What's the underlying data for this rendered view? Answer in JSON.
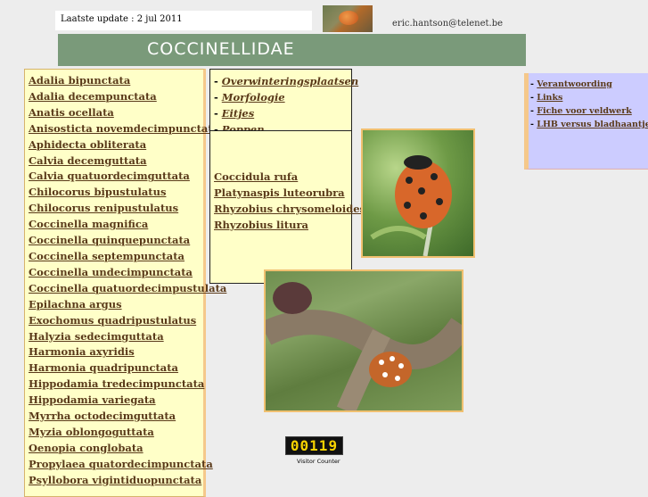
{
  "header": {
    "update_text": "Laatste update : 2 jul 2011",
    "email": "eric.hantson@telenet.be",
    "title": "COCCINELLIDAE"
  },
  "species": [
    "Adalia bipunctata",
    "Adalia decempunctata",
    "Anatis ocellata",
    "Anisosticta novemdecimpunctata",
    "Aphidecta obliterata",
    "Calvia decemguttata",
    "Calvia quatuordecimguttata",
    "Chilocorus bipustulatus",
    "Chilocorus renipustulatus",
    "Coccinella magnifica",
    "Coccinella quinquepunctata",
    "Coccinella septempunctata",
    "Coccinella undecimpunctata",
    "Coccinella quatuordecimpustulata",
    "Epilachna argus",
    "Exochomus quadripustulatus",
    "Halyzia sedecimguttata",
    "Harmonia axyridis",
    "Harmonia quadripunctata",
    "Hippodamia tredecimpunctata",
    "Hippodamia variegata",
    "Myrrha octodecimguttata",
    "Myzia oblongoguttata",
    "Oenopia conglobata",
    "Propylaea quatordecimpunctata",
    "Psyllobora vigintiduopunctata"
  ],
  "topics": [
    "Overwinteringsplaatsen",
    "Morfologie",
    "Eitjes",
    "Poppen"
  ],
  "species_mid": [
    "Coccidula rufa",
    "Platynaspis luteorubra",
    "Rhyzobius chrysomeloides",
    "Rhyzobius litura"
  ],
  "links": [
    "Verantwoording",
    "Links",
    "Fiche voor veldwerk",
    "LHB versus bladhaantjes"
  ],
  "counter": {
    "value": "00119",
    "label": "Visitor Counter"
  }
}
